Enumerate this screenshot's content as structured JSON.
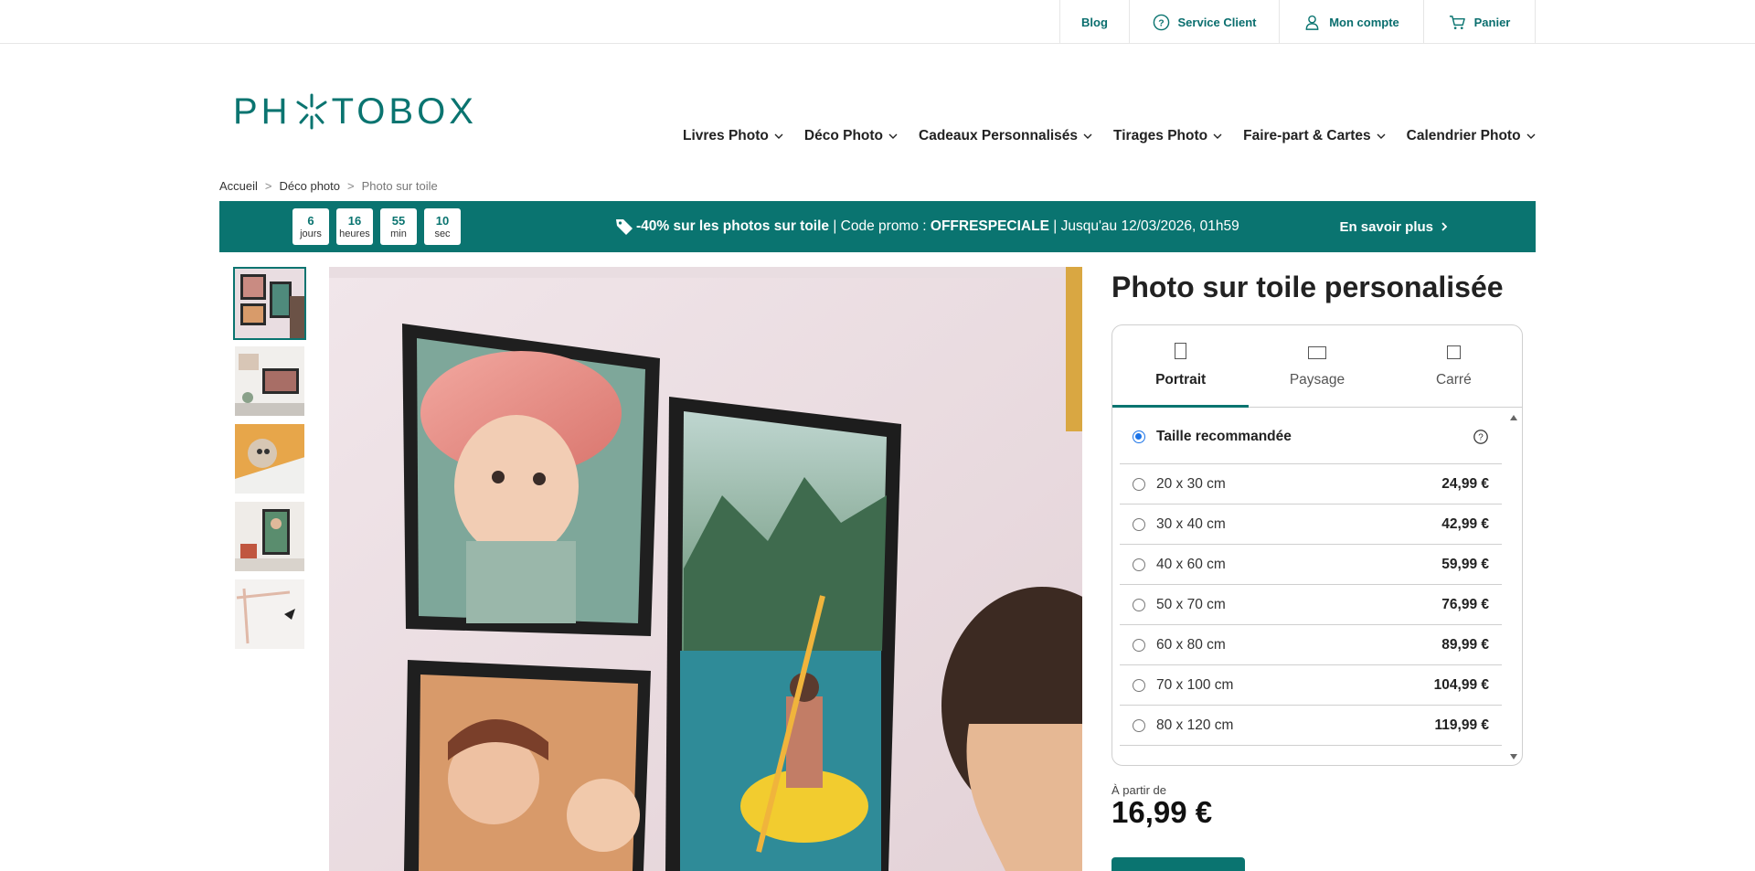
{
  "topbar": {
    "blog": "Blog",
    "service_client": "Service Client",
    "mon_compte": "Mon compte",
    "panier": "Panier"
  },
  "brand": {
    "logo_left": "PH",
    "logo_right": "TOBOX",
    "color": "#0a7470"
  },
  "nav": [
    {
      "label": "Livres Photo"
    },
    {
      "label": "Déco Photo"
    },
    {
      "label": "Cadeaux Personnalisés"
    },
    {
      "label": "Tirages Photo"
    },
    {
      "label": "Faire-part & Cartes"
    },
    {
      "label": "Calendrier Photo"
    }
  ],
  "breadcrumb": {
    "home": "Accueil",
    "sep": ">",
    "level1": "Déco photo",
    "current": "Photo sur toile"
  },
  "promo": {
    "countdown": [
      {
        "num": "6",
        "lbl": "jours"
      },
      {
        "num": "16",
        "lbl": "heures"
      },
      {
        "num": "55",
        "lbl": "min"
      },
      {
        "num": "10",
        "lbl": "sec"
      }
    ],
    "headline": "-40% sur les photos sur toile",
    "separator": " | ",
    "code_label": "Code promo : ",
    "code": "OFFRESPECIALE",
    "until": " | Jusqu'au 12/03/2026, 01h59",
    "more": "En savoir plus"
  },
  "product": {
    "title": "Photo sur toile personalisée",
    "tabs": [
      {
        "label": "Portrait",
        "icon": "portrait-icon"
      },
      {
        "label": "Paysage",
        "icon": "landscape-icon"
      },
      {
        "label": "Carré",
        "icon": "square-icon"
      }
    ],
    "recommended": "Taille recommandée",
    "sizes": [
      {
        "label": "20 x 30 cm",
        "price": "24,99 €"
      },
      {
        "label": "30 x 40 cm",
        "price": "42,99 €"
      },
      {
        "label": "40 x 60 cm",
        "price": "59,99 €"
      },
      {
        "label": "50 x 70 cm",
        "price": "76,99 €"
      },
      {
        "label": "60 x 80 cm",
        "price": "89,99 €"
      },
      {
        "label": "70 x 100 cm",
        "price": "104,99 €"
      },
      {
        "label": "80 x 120 cm",
        "price": "119,99 €"
      }
    ],
    "from_label": "À partir de",
    "from_price": "16,99 €"
  }
}
